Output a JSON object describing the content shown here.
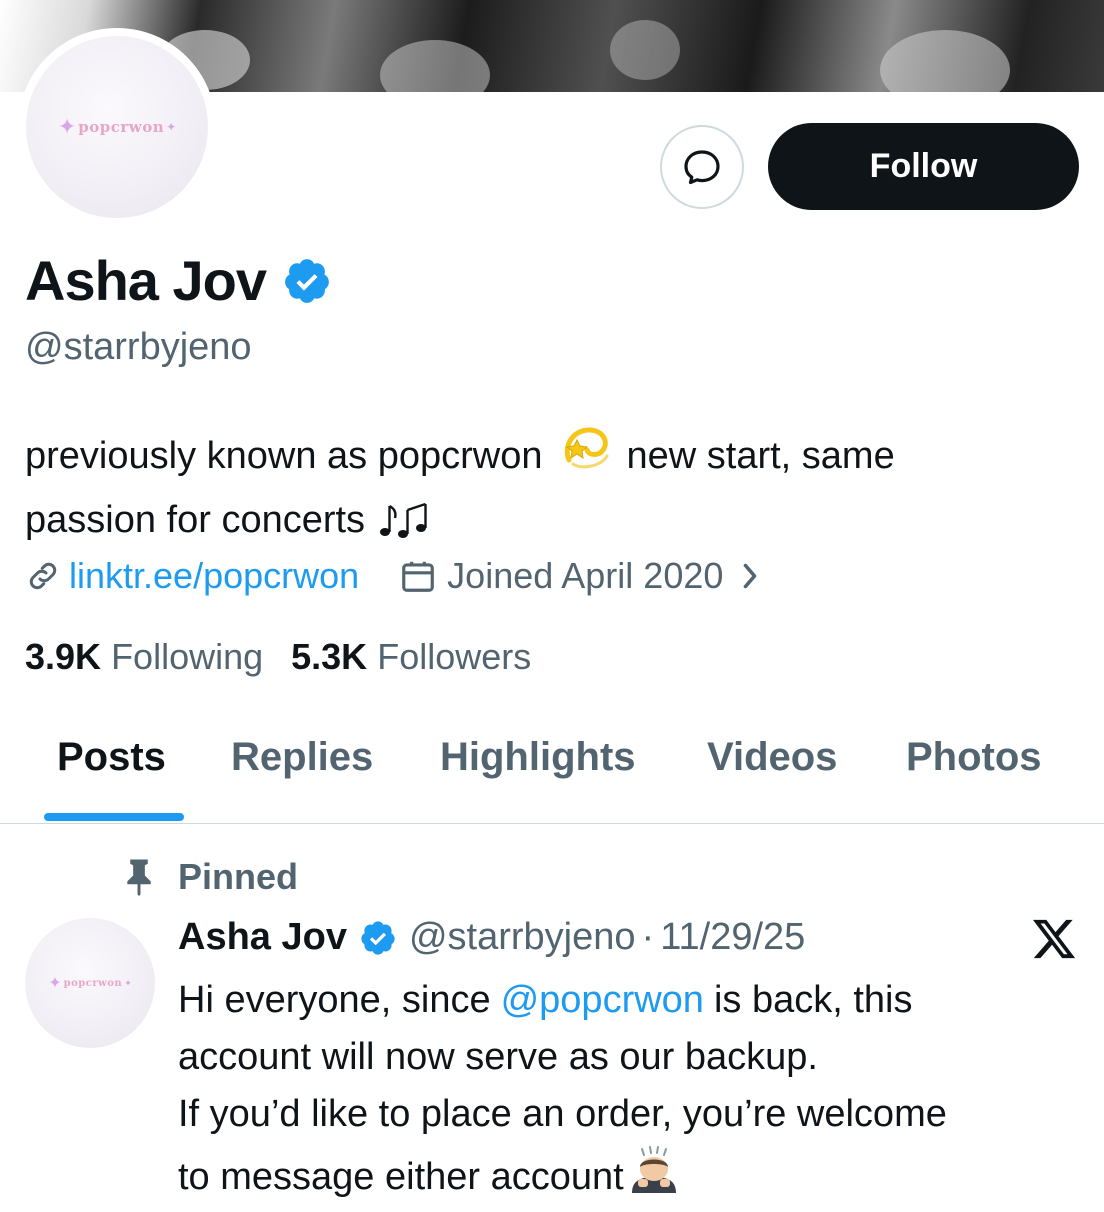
{
  "profile": {
    "name": "Asha Jov",
    "handle": "@starrbyjeno",
    "avatar_text": "popcrwon",
    "follow_label": "Follow",
    "bio_part1": "previously known as popcrwon",
    "bio_part2": "new start, same",
    "bio_line2": "passion for concerts",
    "bio_emojis": [
      "dizzy",
      "notes"
    ],
    "link": "linktr.ee/popcrwon",
    "joined": "Joined April 2020",
    "following_count": "3.9K",
    "following_label": "Following",
    "followers_count": "5.3K",
    "followers_label": "Followers"
  },
  "tabs": [
    {
      "label": "Posts",
      "active": true
    },
    {
      "label": "Replies",
      "active": false
    },
    {
      "label": "Highlights",
      "active": false
    },
    {
      "label": "Videos",
      "active": false
    },
    {
      "label": "Photos",
      "active": false
    }
  ],
  "post": {
    "pinned_label": "Pinned",
    "author": "Asha Jov",
    "handle": "@starrbyjeno",
    "separator": "·",
    "date": "11/29/25",
    "line1_before": "Hi everyone, since",
    "mention": "@popcrwon",
    "line1_after": "is back, this",
    "line2": "account will now serve as our backup.",
    "line3": "If you’d like to place an order, you’re welcome",
    "line4": "to message either account"
  },
  "icons": [
    "message-icon",
    "verified-badge-icon",
    "link-icon",
    "calendar-icon",
    "chevron-right-icon",
    "pin-icon",
    "x-logo-icon",
    "dizzy-emoji-icon",
    "music-notes-icon",
    "bowing-person-emoji-icon"
  ],
  "colors": {
    "accent": "#1d9bf0",
    "text": "#0f1419",
    "secondary": "#536471",
    "border": "#cfd9de",
    "button_bg": "#0f1419"
  }
}
